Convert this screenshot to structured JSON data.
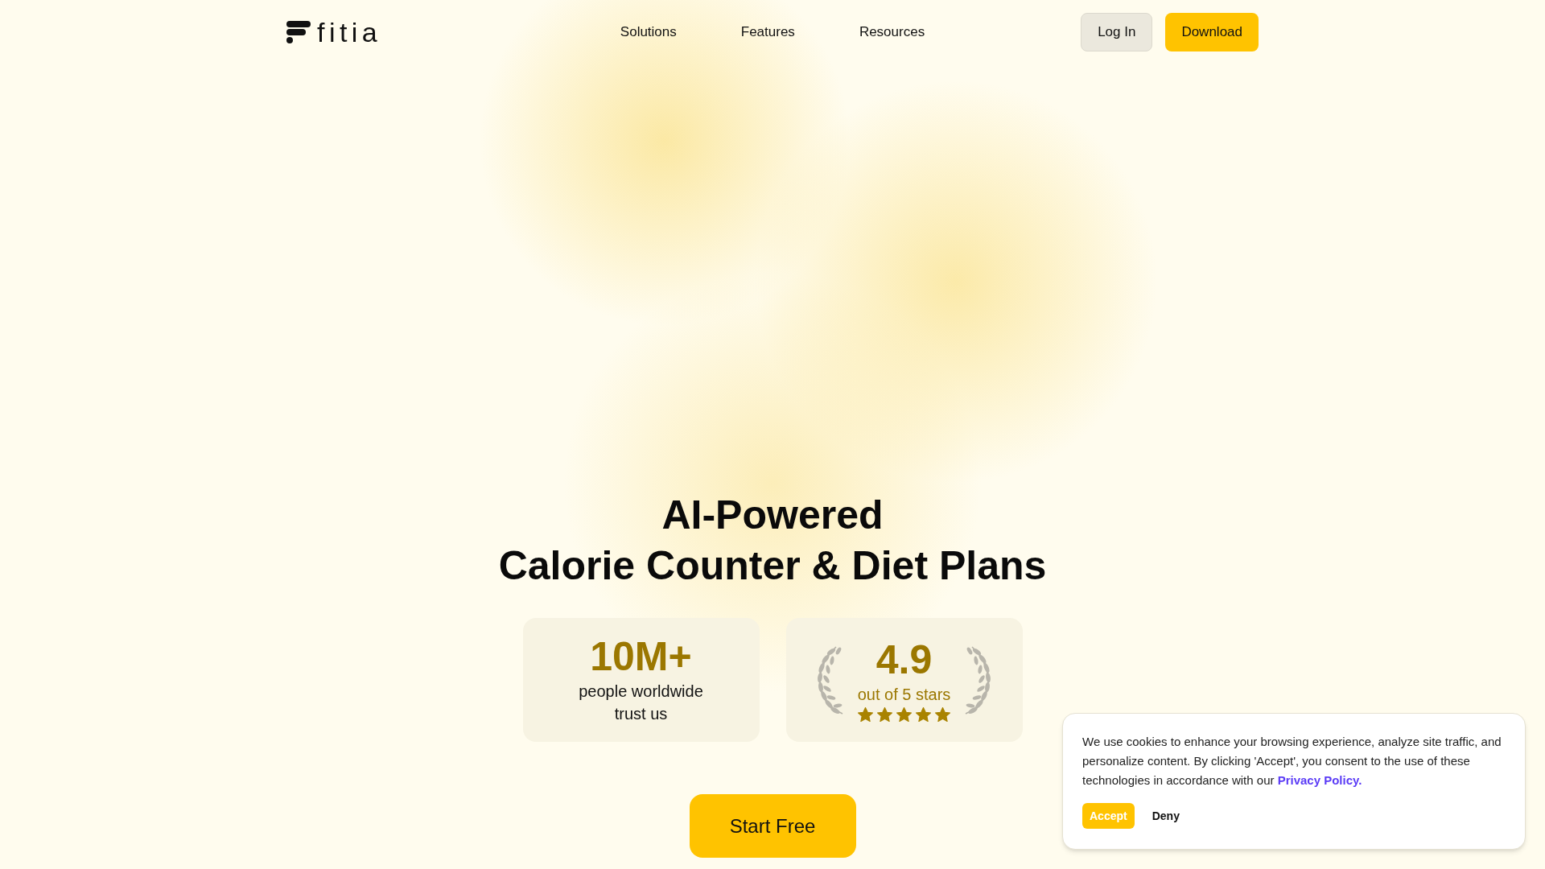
{
  "header": {
    "logo": {
      "wordmark": "fitia"
    },
    "nav": [
      {
        "label": "Solutions"
      },
      {
        "label": "Features"
      },
      {
        "label": "Resources"
      }
    ],
    "actions": [
      {
        "label": "Log In",
        "kind": "secondary"
      },
      {
        "label": "Download",
        "kind": "primary"
      }
    ]
  },
  "hero": {
    "title_lines": [
      "AI-Powered",
      "Calorie Counter & Diet Plans"
    ],
    "stats": [
      {
        "kind": "count",
        "value": "10M+",
        "caption_lines": [
          "people worldwide",
          "trust us"
        ]
      },
      {
        "kind": "rating",
        "value": "4.9",
        "caption_lines": [
          "out of 5 stars"
        ],
        "stars": 5
      }
    ],
    "cta": {
      "label": "Start Free"
    }
  },
  "cookie_banner": {
    "message": "We use cookies to enhance your browsing experience, analyze site traffic, and personalize content. By clicking 'Accept', you consent to the use of these technologies in accordance with our",
    "link": "Privacy Policy.",
    "buttons": [
      {
        "label": "Accept",
        "kind": "primary"
      },
      {
        "label": "Deny",
        "kind": "text"
      }
    ]
  }
}
